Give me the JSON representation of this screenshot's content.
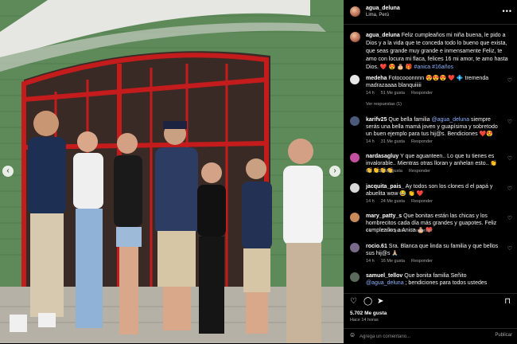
{
  "post": {
    "username": "agua_deluna",
    "location": "Lima, Perú",
    "more_label": "•••",
    "caption_user": "agua_deluna",
    "caption_text": " Feliz cumpleaños mi niña buena, le pido a Dios y a la vida que te conceda todo lo bueno que exista, que seas grande muy grande e inmensamente Feliz, te amo con locura mi flaca, felices 16 mi amor, te amo hasta Dios. ❤️ 😍 🎂 🎁 ",
    "caption_tags": "#anica #16años"
  },
  "comments": [
    {
      "user": "medeha",
      "text": " Fotocooonnnn 😍😍😍 ❤️ 💠 tremenda madrazaaaa blanquiiiii",
      "time": "14 h",
      "likes": "51 Me gusta",
      "reply": "Responder",
      "avatar_color": "#e8e8e8",
      "replies": "Ver respuestas (1)"
    },
    {
      "user": "karifv25",
      "text": " Que bella familia ",
      "mention": "@agua_deluna",
      "text2": " siempre serás una bella mamá joven y guapísima y sobretodo un buen ejemplo para tus hij@s. Bendiciones ❤️😍",
      "time": "14 h",
      "likes": "31 Me gusta",
      "reply": "Responder",
      "avatar_color": "#4a5a7a"
    },
    {
      "user": "nardasagluy",
      "text": " Y que aguanteen.. Lo que tu tienes es invalorable.. Mientras otras lloran y anhelan esto.. 👏👏👏👏👏",
      "time": "6 h",
      "likes": "19 Me gusta",
      "reply": "Responder",
      "avatar_color": "#c44fa0"
    },
    {
      "user": "jacquita_pais_",
      "text": " Ay todos son los clones d el papá y abuelita wow 😂 👏 ❤️",
      "time": "14 h",
      "likes": "24 Me gusta",
      "reply": "Responder",
      "avatar_color": "#d9d9d9"
    },
    {
      "user": "mary_patty_s",
      "text": " Que bonitas están las chicas y los hombrecitos cada día más grandes y guapotes. Feliz cumpleaños a Anica 🎂 ❤️",
      "time": "14 h",
      "likes": "12 Me gusta",
      "reply": "Responder",
      "avatar_color": "#c98a5a"
    },
    {
      "user": "rocio.61",
      "text": " Sra. Blanca que linda su familia y que bellos sus hij@s 🙏🏼",
      "time": "14 h",
      "likes": "16 Me gusta",
      "reply": "Responder",
      "avatar_color": "#7a6a8a"
    },
    {
      "user": "samuel_tellov",
      "text": " Que bonita familia Señito ",
      "mention": "@agua_deluna",
      "text2": " ; bendiciones para todos ustedes",
      "time": "",
      "likes": "",
      "reply": "",
      "avatar_color": "#5a6a5a"
    }
  ],
  "footer": {
    "likes": "5.702 Me gusta",
    "when": "Hace 14 horas",
    "comment_placeholder": "Agrega un comentario...",
    "publish": "Publicar"
  },
  "icons": [
    "heart-icon",
    "comment-icon",
    "share-icon",
    "bookmark-icon",
    "emoji-icon",
    "chevron-left-icon",
    "chevron-right-icon"
  ]
}
